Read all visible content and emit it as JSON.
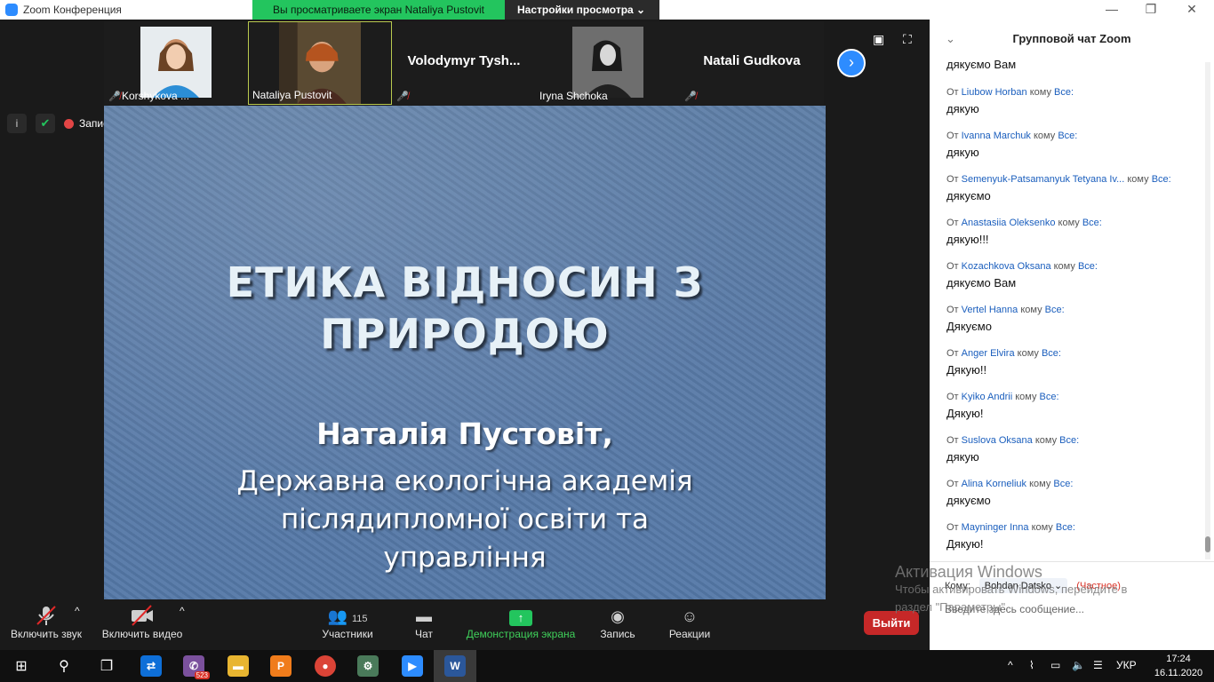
{
  "titlebar": {
    "title": "Zoom Конференция",
    "share_notice": "Вы просматриваете экран Nataliya Pustovit",
    "view_options": "Настройки просмотра ⌄"
  },
  "participants": [
    {
      "name": "Korshykova ...",
      "muted": true,
      "photo": true
    },
    {
      "name": "Nataliya Pustovit",
      "muted": false,
      "photo": true,
      "active": true
    },
    {
      "name": "Volodymyr  Tysh...",
      "muted": true,
      "photo": false
    },
    {
      "name": "Iryna Shchoka",
      "muted": false,
      "photo": true
    },
    {
      "name": "Natali Gudkova",
      "muted": true,
      "photo": false
    }
  ],
  "recording_label": "Запись",
  "slide": {
    "title_line1": "ЕТИКА ВІДНОСИН З",
    "title_line2": "ПРИРОДОЮ",
    "author": "Наталія Пустовіт,",
    "org_line1": "Державна екологічна академія",
    "org_line2": "післядипломної освіти та",
    "org_line3": "управління"
  },
  "toolbar": {
    "audio": "Включить звук",
    "video": "Включить видео",
    "participants": "Участники",
    "participants_count": "115",
    "chat": "Чат",
    "share": "Демонстрация экрана",
    "record": "Запись",
    "reactions": "Реакции",
    "exit": "Выйти"
  },
  "chat": {
    "header": "Групповой чат Zoom",
    "first_text": "дякуємо Вам",
    "from_word": "От",
    "to_word": "кому",
    "everyone": "Все:",
    "messages": [
      {
        "from": "Liubow Horban",
        "text": "дякую"
      },
      {
        "from": "Ivanna Marchuk",
        "text": "дякую"
      },
      {
        "from": "Semenyuk-Patsamanyuk Tetyana Iv...",
        "text": "дякуємо"
      },
      {
        "from": "Anastasiia Oleksenko",
        "text": "дякую!!!"
      },
      {
        "from": "Kozachkova Oksana",
        "text": "дякуємо Вам"
      },
      {
        "from": "Vertel Hanna",
        "text": "Дякуємо"
      },
      {
        "from": "Anger Elvira",
        "text": "Дякую!!"
      },
      {
        "from": "Kyiko Andrii",
        "text": "Дякую!"
      },
      {
        "from": "Suslova Oksana",
        "text": "дякую"
      },
      {
        "from": "Alina Korneliuk",
        "text": "дякуємо"
      },
      {
        "from": "Mayninger Inna",
        "text": "Дякую!"
      }
    ],
    "to_label": "Кому:",
    "recipient": "Bohdan Datsko ⌄",
    "private_label": "(Частное)",
    "input_placeholder": "Введите здесь сообщение..."
  },
  "watermark": {
    "line1": "Активация Windows",
    "line2": "Чтобы активировать Windows, перейдите в",
    "line3": "раздел \"Параметры\"."
  },
  "taskbar": {
    "viber_badge": "523",
    "lang": "УКР",
    "time": "17:24",
    "date": "16.11.2020"
  },
  "colors": {
    "accent": "#2d8cff",
    "share_green": "#23c55e",
    "exit_red": "#c62828"
  }
}
